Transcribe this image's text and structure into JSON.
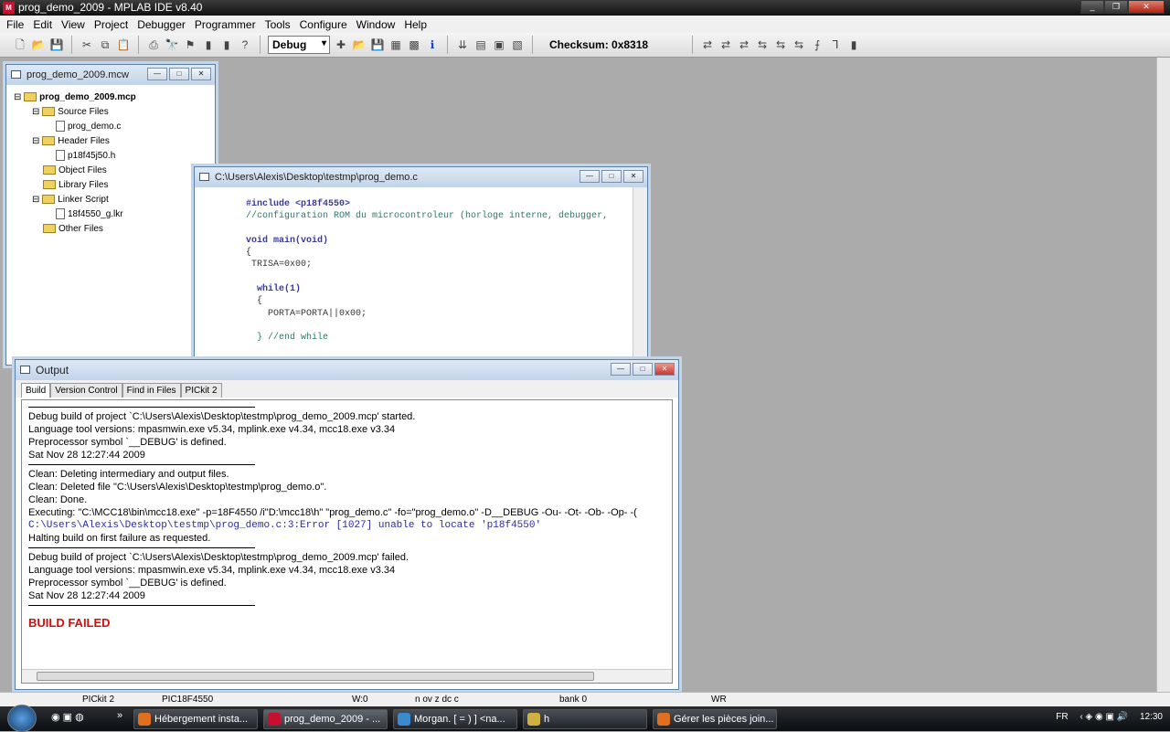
{
  "app": {
    "title": "prog_demo_2009 - MPLAB IDE v8.40",
    "logo": "M"
  },
  "menu": [
    "File",
    "Edit",
    "View",
    "Project",
    "Debugger",
    "Programmer",
    "Tools",
    "Configure",
    "Window",
    "Help"
  ],
  "toolbar": {
    "config": "Debug",
    "checksum": "Checksum:  0x8318"
  },
  "workspace": {
    "title": "prog_demo_2009.mcw",
    "project": "prog_demo_2009.mcp",
    "source_files": "Source Files",
    "source": "prog_demo.c",
    "header_files": "Header Files",
    "header": "p18f45j50.h",
    "object_files": "Object Files",
    "library_files": "Library Files",
    "linker_script": "Linker Script",
    "linker": "18f4550_g.lkr",
    "other_files": "Other Files"
  },
  "editor": {
    "title": "C:\\Users\\Alexis\\Desktop\\testmp\\prog_demo.c",
    "lines": [
      "#include <p18f4550>",
      "//configuration ROM du microcontroleur (horloge interne, debugger,",
      "",
      "void main(void)",
      "{",
      " TRISA=0x00;",
      "",
      "  while(1)",
      "  {",
      "    PORTA=PORTA||0x00;",
      "",
      "  } //end while"
    ]
  },
  "output": {
    "title": "Output",
    "tabs": [
      "Build",
      "Version Control",
      "Find in Files",
      "PICkit 2"
    ],
    "block1": [
      "Debug build of project `C:\\Users\\Alexis\\Desktop\\testmp\\prog_demo_2009.mcp' started.",
      "Language tool versions: mpasmwin.exe v5.34, mplink.exe v4.34, mcc18.exe v3.34",
      "Preprocessor symbol `__DEBUG' is defined.",
      "Sat Nov 28 12:27:44 2009"
    ],
    "block2a": [
      "Clean: Deleting intermediary and output files.",
      "Clean: Deleted file \"C:\\Users\\Alexis\\Desktop\\testmp\\prog_demo.o\".",
      "Clean: Done.",
      "Executing: \"C:\\MCC18\\bin\\mcc18.exe\" -p=18F4550 /i\"D:\\mcc18\\h\" \"prog_demo.c\" -fo=\"prog_demo.o\" -D__DEBUG -Ou- -Ot- -Ob- -Op- -("
    ],
    "error": "C:\\Users\\Alexis\\Desktop\\testmp\\prog_demo.c:3:Error [1027] unable to locate 'p18f4550'",
    "halt": "Halting build on first failure as requested.",
    "block3": [
      "Debug build of project `C:\\Users\\Alexis\\Desktop\\testmp\\prog_demo_2009.mcp' failed.",
      "Language tool versions: mpasmwin.exe v5.34, mplink.exe v4.34, mcc18.exe v3.34",
      "Preprocessor symbol `__DEBUG' is defined.",
      "Sat Nov 28 12:27:44 2009"
    ],
    "result": "BUILD FAILED"
  },
  "status": {
    "tool": "PICkit 2",
    "device": "PIC18F4550",
    "w": "W:0",
    "flags": "n ov z dc c",
    "bank": "bank 0",
    "wr": "WR"
  },
  "taskbar": {
    "chevron": "»",
    "tasks": [
      "Hébergement insta...",
      "prog_demo_2009 - ...",
      "Morgan. [ = ) ] <na...",
      "h",
      "Gérer les pièces join..."
    ],
    "lang": "FR",
    "time": "12:30"
  }
}
